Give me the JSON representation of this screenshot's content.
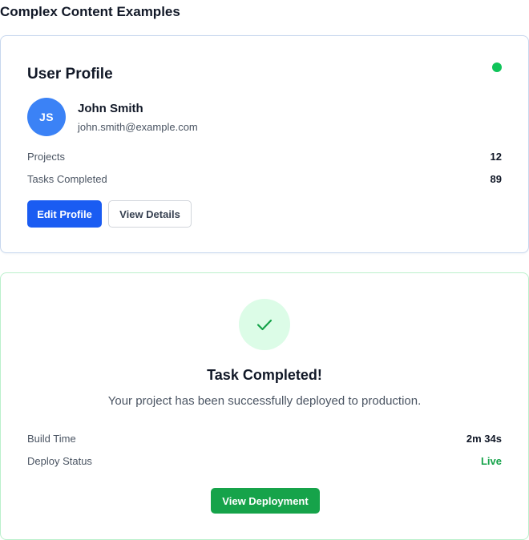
{
  "page": {
    "title": "Complex Content Examples"
  },
  "profile": {
    "title": "User Profile",
    "initials": "JS",
    "name": "John Smith",
    "email": "john.smith@example.com",
    "online_color": "#10c45a",
    "stats": [
      {
        "label": "Projects",
        "value": "12"
      },
      {
        "label": "Tasks Completed",
        "value": "89"
      }
    ],
    "edit_label": "Edit Profile",
    "details_label": "View Details"
  },
  "task": {
    "icon": "checkmark-icon",
    "title": "Task Completed!",
    "description": "Your project has been successfully deployed to production.",
    "stats": [
      {
        "label": "Build Time",
        "value": "2m 34s"
      },
      {
        "label": "Deploy Status",
        "value": "Live",
        "color": "#16a34a"
      }
    ],
    "button_label": "View Deployment"
  },
  "colors": {
    "primary": "#1a5cf2",
    "success": "#16a34a",
    "avatar": "#3b82f6"
  }
}
